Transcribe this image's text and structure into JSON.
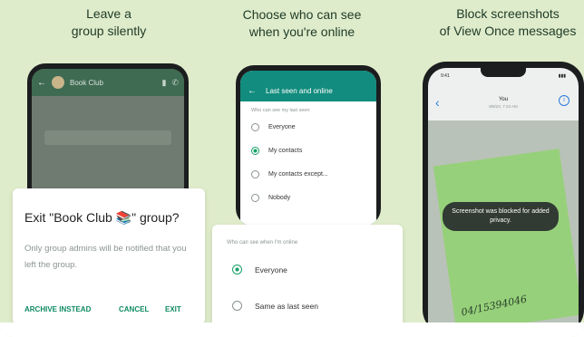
{
  "colors": {
    "background": "#dfeccb",
    "heading_text": "#1e3a26",
    "whatsapp_green": "#128c7e",
    "selected_radio": "#1aa06a"
  },
  "panel1": {
    "heading": "Leave a\ngroup silently",
    "chat_title": "Book Club",
    "dialog": {
      "title": "Exit \"Book Club 📚\" group?",
      "body": "Only group admins will be notified that you left the group.",
      "buttons": [
        "ARCHIVE INSTEAD",
        "CANCEL",
        "EXIT"
      ]
    }
  },
  "panel2": {
    "heading": "Choose who can see\nwhen you're online",
    "screen_title": "Last seen and online",
    "subheading": "Who can see my last seen",
    "options": [
      "Everyone",
      "My contacts",
      "My contacts except...",
      "Nobody"
    ],
    "selected_option": 1,
    "card": {
      "title": "Who can see when I'm online",
      "options": [
        "Everyone",
        "Same as last seen"
      ],
      "selected_option": 0
    }
  },
  "panel3": {
    "heading": "Block screenshots\nof View Once messages",
    "status_time": "9:41",
    "contact_name": "You",
    "contact_sub": "9/9/23, 7:23 AM",
    "toast": "Screenshot was blocked for added privacy.",
    "note_text": "04/15394046"
  }
}
